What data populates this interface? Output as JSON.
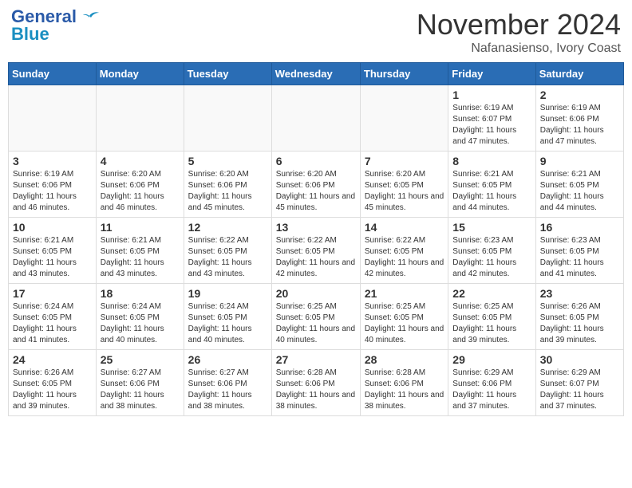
{
  "header": {
    "logo_line1": "General",
    "logo_line2": "Blue",
    "month": "November 2024",
    "location": "Nafanasienso, Ivory Coast"
  },
  "days_of_week": [
    "Sunday",
    "Monday",
    "Tuesday",
    "Wednesday",
    "Thursday",
    "Friday",
    "Saturday"
  ],
  "weeks": [
    [
      {
        "day": "",
        "info": ""
      },
      {
        "day": "",
        "info": ""
      },
      {
        "day": "",
        "info": ""
      },
      {
        "day": "",
        "info": ""
      },
      {
        "day": "",
        "info": ""
      },
      {
        "day": "1",
        "info": "Sunrise: 6:19 AM\nSunset: 6:07 PM\nDaylight: 11 hours and 47 minutes."
      },
      {
        "day": "2",
        "info": "Sunrise: 6:19 AM\nSunset: 6:06 PM\nDaylight: 11 hours and 47 minutes."
      }
    ],
    [
      {
        "day": "3",
        "info": "Sunrise: 6:19 AM\nSunset: 6:06 PM\nDaylight: 11 hours and 46 minutes."
      },
      {
        "day": "4",
        "info": "Sunrise: 6:20 AM\nSunset: 6:06 PM\nDaylight: 11 hours and 46 minutes."
      },
      {
        "day": "5",
        "info": "Sunrise: 6:20 AM\nSunset: 6:06 PM\nDaylight: 11 hours and 45 minutes."
      },
      {
        "day": "6",
        "info": "Sunrise: 6:20 AM\nSunset: 6:06 PM\nDaylight: 11 hours and 45 minutes."
      },
      {
        "day": "7",
        "info": "Sunrise: 6:20 AM\nSunset: 6:05 PM\nDaylight: 11 hours and 45 minutes."
      },
      {
        "day": "8",
        "info": "Sunrise: 6:21 AM\nSunset: 6:05 PM\nDaylight: 11 hours and 44 minutes."
      },
      {
        "day": "9",
        "info": "Sunrise: 6:21 AM\nSunset: 6:05 PM\nDaylight: 11 hours and 44 minutes."
      }
    ],
    [
      {
        "day": "10",
        "info": "Sunrise: 6:21 AM\nSunset: 6:05 PM\nDaylight: 11 hours and 43 minutes."
      },
      {
        "day": "11",
        "info": "Sunrise: 6:21 AM\nSunset: 6:05 PM\nDaylight: 11 hours and 43 minutes."
      },
      {
        "day": "12",
        "info": "Sunrise: 6:22 AM\nSunset: 6:05 PM\nDaylight: 11 hours and 43 minutes."
      },
      {
        "day": "13",
        "info": "Sunrise: 6:22 AM\nSunset: 6:05 PM\nDaylight: 11 hours and 42 minutes."
      },
      {
        "day": "14",
        "info": "Sunrise: 6:22 AM\nSunset: 6:05 PM\nDaylight: 11 hours and 42 minutes."
      },
      {
        "day": "15",
        "info": "Sunrise: 6:23 AM\nSunset: 6:05 PM\nDaylight: 11 hours and 42 minutes."
      },
      {
        "day": "16",
        "info": "Sunrise: 6:23 AM\nSunset: 6:05 PM\nDaylight: 11 hours and 41 minutes."
      }
    ],
    [
      {
        "day": "17",
        "info": "Sunrise: 6:24 AM\nSunset: 6:05 PM\nDaylight: 11 hours and 41 minutes."
      },
      {
        "day": "18",
        "info": "Sunrise: 6:24 AM\nSunset: 6:05 PM\nDaylight: 11 hours and 40 minutes."
      },
      {
        "day": "19",
        "info": "Sunrise: 6:24 AM\nSunset: 6:05 PM\nDaylight: 11 hours and 40 minutes."
      },
      {
        "day": "20",
        "info": "Sunrise: 6:25 AM\nSunset: 6:05 PM\nDaylight: 11 hours and 40 minutes."
      },
      {
        "day": "21",
        "info": "Sunrise: 6:25 AM\nSunset: 6:05 PM\nDaylight: 11 hours and 40 minutes."
      },
      {
        "day": "22",
        "info": "Sunrise: 6:25 AM\nSunset: 6:05 PM\nDaylight: 11 hours and 39 minutes."
      },
      {
        "day": "23",
        "info": "Sunrise: 6:26 AM\nSunset: 6:05 PM\nDaylight: 11 hours and 39 minutes."
      }
    ],
    [
      {
        "day": "24",
        "info": "Sunrise: 6:26 AM\nSunset: 6:05 PM\nDaylight: 11 hours and 39 minutes."
      },
      {
        "day": "25",
        "info": "Sunrise: 6:27 AM\nSunset: 6:06 PM\nDaylight: 11 hours and 38 minutes."
      },
      {
        "day": "26",
        "info": "Sunrise: 6:27 AM\nSunset: 6:06 PM\nDaylight: 11 hours and 38 minutes."
      },
      {
        "day": "27",
        "info": "Sunrise: 6:28 AM\nSunset: 6:06 PM\nDaylight: 11 hours and 38 minutes."
      },
      {
        "day": "28",
        "info": "Sunrise: 6:28 AM\nSunset: 6:06 PM\nDaylight: 11 hours and 38 minutes."
      },
      {
        "day": "29",
        "info": "Sunrise: 6:29 AM\nSunset: 6:06 PM\nDaylight: 11 hours and 37 minutes."
      },
      {
        "day": "30",
        "info": "Sunrise: 6:29 AM\nSunset: 6:07 PM\nDaylight: 11 hours and 37 minutes."
      }
    ]
  ]
}
